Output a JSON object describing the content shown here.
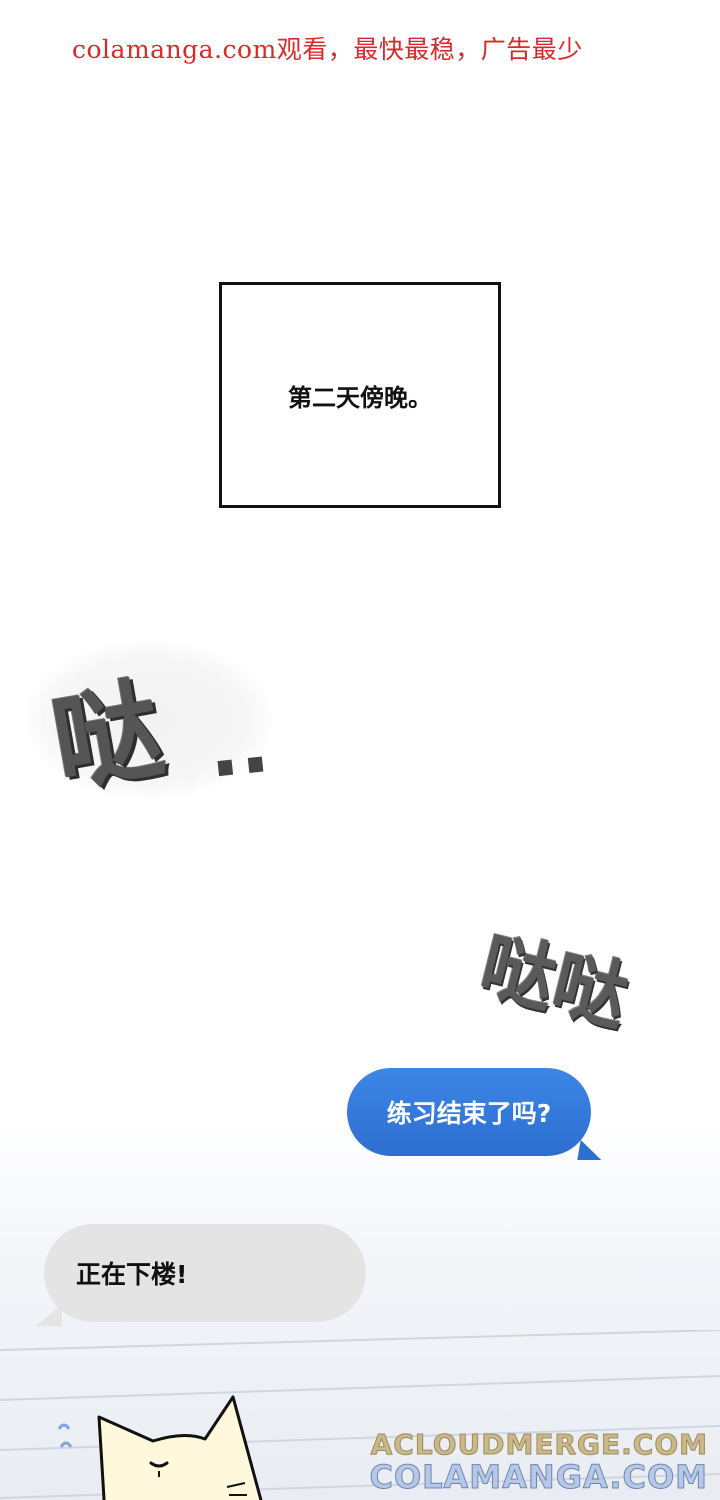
{
  "banner": {
    "text": "colamanga.com观看，最快最稳，广告最少"
  },
  "caption": {
    "text": "第二天傍晚。"
  },
  "sfx": {
    "first": "哒",
    "first_dots": "..",
    "second": "哒哒"
  },
  "chat": {
    "outgoing": "练习结束了吗?",
    "incoming": "正在下楼!"
  },
  "watermarks": {
    "line1": "ACLOUDMERGE.COM",
    "line2": "COLAMANGA.COM"
  },
  "colors": {
    "banner": "#d82a2a",
    "outgoing_bubble": "#3d86e6",
    "incoming_bubble": "#e4e4e4"
  }
}
